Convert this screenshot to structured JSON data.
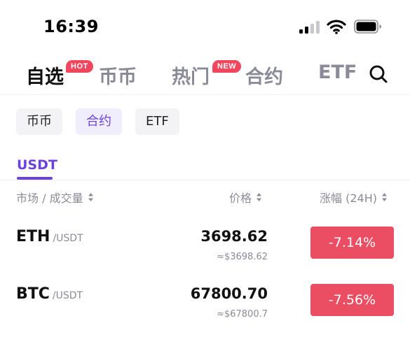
{
  "status_bar": {
    "time": "16:39"
  },
  "top_tabs": [
    {
      "label": "自选",
      "badge": "HOT",
      "active": true
    },
    {
      "label": "币币",
      "active": false
    },
    {
      "label": "热门",
      "badge": "NEW",
      "active": false
    },
    {
      "label": "合约",
      "active": false
    },
    {
      "label": "ETF",
      "active": false
    }
  ],
  "sub_tabs": [
    {
      "label": "币币",
      "active": false
    },
    {
      "label": "合约",
      "active": true
    },
    {
      "label": "ETF",
      "active": false
    }
  ],
  "quote_tab": "USDT",
  "columns": {
    "market": "市场 / 成交量",
    "price": "价格",
    "change": "涨幅 (24H)"
  },
  "rows": [
    {
      "symbol": "ETH",
      "quote": "/USDT",
      "price": "3698.62",
      "fiat": "≈$3698.62",
      "change": "-7.14%"
    },
    {
      "symbol": "BTC",
      "quote": "/USDT",
      "price": "67800.70",
      "fiat": "≈$67800.7",
      "change": "-7.56%"
    }
  ],
  "icons": {
    "search": "search-icon",
    "sort": "sort-icon",
    "signal": "signal-icon",
    "wifi": "wifi-icon",
    "battery": "battery-icon"
  },
  "colors": {
    "accent": "#6b42e0",
    "negative": "#eb4d62",
    "badge": "#f0475f",
    "muted": "#8b8b98"
  }
}
